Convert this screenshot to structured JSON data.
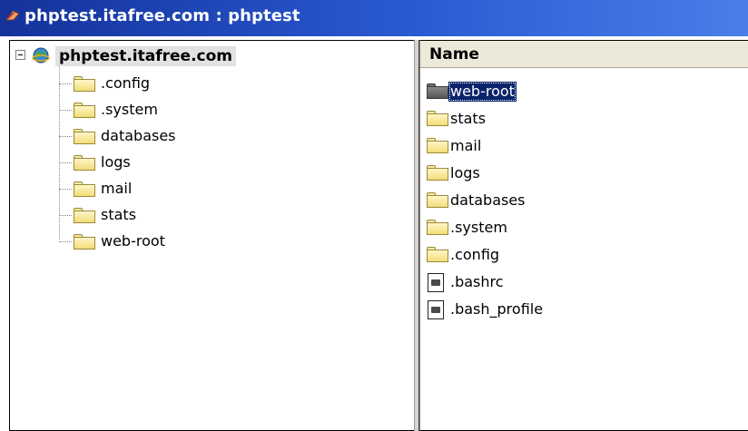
{
  "window": {
    "title": "phptest.itafree.com : phptest",
    "app_icon": "app-icon"
  },
  "tree": {
    "root_label": "phptest.itafree.com",
    "root_icon": "globe-icon",
    "expander": "minus",
    "items": [
      {
        "label": ".config"
      },
      {
        "label": ".system"
      },
      {
        "label": "databases"
      },
      {
        "label": "logs"
      },
      {
        "label": "mail"
      },
      {
        "label": "stats"
      },
      {
        "label": "web-root"
      }
    ]
  },
  "list": {
    "column_header": "Name",
    "items": [
      {
        "label": "web-root",
        "icon": "folder-icon",
        "selected": true
      },
      {
        "label": "stats",
        "icon": "folder-icon"
      },
      {
        "label": "mail",
        "icon": "folder-icon"
      },
      {
        "label": "logs",
        "icon": "folder-icon"
      },
      {
        "label": "databases",
        "icon": "folder-icon"
      },
      {
        "label": ".system",
        "icon": "folder-icon"
      },
      {
        "label": ".config",
        "icon": "folder-icon"
      },
      {
        "label": ".bashrc",
        "icon": "file-icon"
      },
      {
        "label": ".bash_profile",
        "icon": "file-icon"
      }
    ]
  },
  "colors": {
    "titlebar": "#14329a",
    "selection": "#0a246a",
    "folder": "#f3dc78"
  }
}
